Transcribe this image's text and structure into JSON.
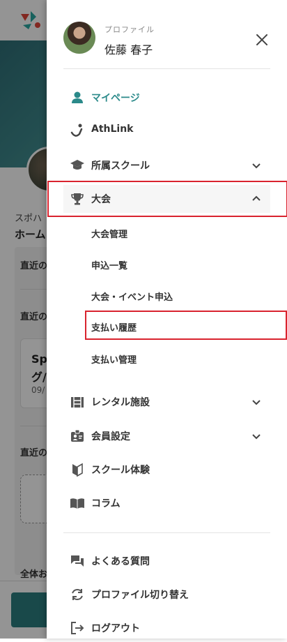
{
  "background": {
    "subtitle": "スポハ",
    "home_label": "ホーム",
    "section_1": "直近の",
    "section_2": "直近の",
    "card_title_line1": "Sp",
    "card_title_line2": "グ/",
    "card_date": "09/",
    "section_3": "直近の",
    "section_4": "全体お"
  },
  "drawer": {
    "profile": {
      "caption": "プロファイル",
      "name": "佐藤 春子"
    },
    "menu": [
      {
        "label": "マイページ",
        "icon": "person-icon",
        "active": true
      },
      {
        "label": "AthLink",
        "icon": "athlink-icon"
      },
      {
        "label": "所属スクール",
        "icon": "graduation-cap-icon",
        "chevron": "down"
      },
      {
        "label": "大会",
        "icon": "trophy-icon",
        "chevron": "up"
      },
      {
        "label": "レンタル施設",
        "icon": "stadium-icon",
        "chevron": "down"
      },
      {
        "label": "会員設定",
        "icon": "id-badge-icon",
        "chevron": "down"
      },
      {
        "label": "スクール体験",
        "icon": "beginner-mark-icon"
      },
      {
        "label": "コラム",
        "icon": "open-book-icon"
      }
    ],
    "submenu": [
      {
        "label": "大会管理"
      },
      {
        "label": "申込一覧"
      },
      {
        "label": "大会・イベント申込"
      },
      {
        "label": "支払い履歴"
      },
      {
        "label": "支払い管理"
      }
    ],
    "footer_menu": [
      {
        "label": "よくある質問",
        "icon": "chat-icon"
      },
      {
        "label": "プロファイル切り替え",
        "icon": "switch-icon"
      },
      {
        "label": "ログアウト",
        "icon": "logout-icon"
      }
    ]
  },
  "colors": {
    "accent": "#2b8a8a",
    "highlight": "#d9232e"
  }
}
